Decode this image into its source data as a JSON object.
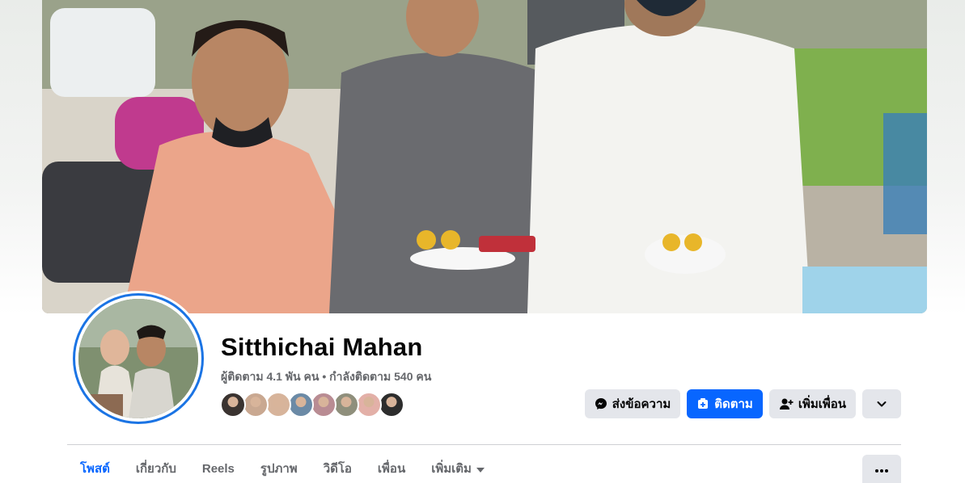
{
  "profile": {
    "name": "Sitthichai Mahan",
    "stats": "ผู้ติดตาม 4.1 พัน คน • กำลังติดตาม 540 คน"
  },
  "friends_preview": {
    "count": 8,
    "colors": [
      "#3a3330",
      "#c9a891",
      "#d7b49b",
      "#6b8aa6",
      "#b98c93",
      "#8f8f7c",
      "#e3b0a8",
      "#2d2d2d"
    ]
  },
  "actions": {
    "message_label": "ส่งข้อความ",
    "follow_label": "ติดตาม",
    "add_friend_label": "เพิ่มเพื่อน"
  },
  "tabs": [
    {
      "label": "โพสต์",
      "active": true
    },
    {
      "label": "เกี่ยวกับ",
      "active": false
    },
    {
      "label": "Reels",
      "active": false
    },
    {
      "label": "รูปภาพ",
      "active": false
    },
    {
      "label": "วิดีโอ",
      "active": false
    },
    {
      "label": "เพื่อน",
      "active": false
    },
    {
      "label": "เพิ่มเติม",
      "active": false
    }
  ],
  "colors": {
    "accent": "#0866ff",
    "avatar_ring": "#1b74e4",
    "button_gray": "#e4e6eb",
    "text_secondary": "#65676b"
  },
  "icons": {
    "message": "messenger-icon",
    "follow": "follow-icon",
    "add_friend": "add-friend-icon",
    "expand": "chevron-down-icon",
    "tab_more": "caret-down-icon",
    "overflow": "more-dots-icon"
  }
}
